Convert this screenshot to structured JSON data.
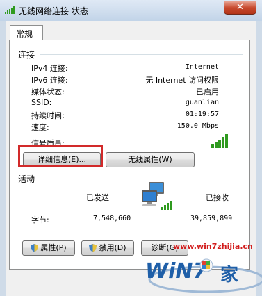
{
  "window": {
    "title": "无线网络连接 状态",
    "close_label": "✕"
  },
  "tab": {
    "label": "常规"
  },
  "connection": {
    "heading": "连接",
    "rows": [
      {
        "label": "IPv4 连接:",
        "value": "Internet"
      },
      {
        "label": "IPv6 连接:",
        "value": "无 Internet 访问权限"
      },
      {
        "label": "媒体状态:",
        "value": "已启用"
      },
      {
        "label": "SSID:",
        "value": "guanlian"
      },
      {
        "label": "持续时间:",
        "value": "01:19:57"
      },
      {
        "label": "速度:",
        "value": "150.0 Mbps"
      }
    ],
    "signal_label": "信号质量:",
    "signal_bars": 5,
    "details_button": "详细信息(E)...",
    "wireless_props_button": "无线属性(W)"
  },
  "activity": {
    "heading": "活动",
    "sent_label": "已发送",
    "received_label": "已接收",
    "bytes_label": "字节:",
    "sent_bytes": "7,548,660",
    "received_bytes": "39,859,899"
  },
  "buttons": {
    "properties": "属性(P)",
    "disable": "禁用(D)",
    "diagnose": "诊断(G)"
  },
  "watermark": {
    "site": "www.win7zhijia.cn",
    "logo_text": "WiN7",
    "logo_suffix": "之家"
  },
  "colors": {
    "highlight_box": "#d22a2a",
    "signal_green": "#2f9a1f",
    "title_bar": "#c2d4e8"
  }
}
